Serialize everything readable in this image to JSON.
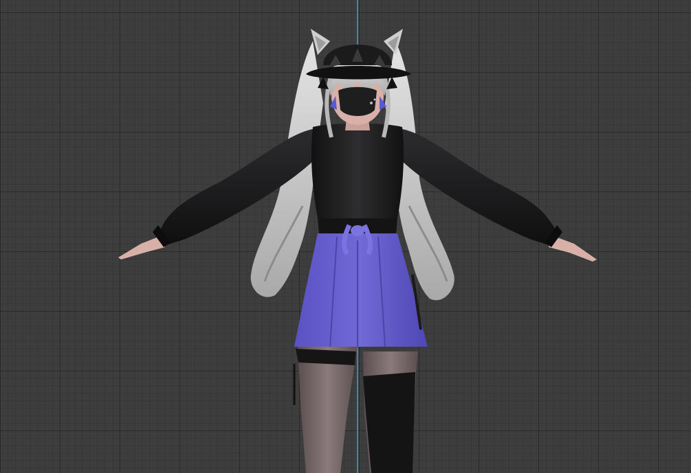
{
  "viewport": {
    "background_color": "#3d3d3d",
    "grid_color": "#2f2f2f",
    "z_axis_color": "#4f7bb6",
    "grid_visible": true
  },
  "model": {
    "colors": {
      "jacket": "#1a1a1b",
      "jacket_highlight": "#3a3a3c",
      "skirt": "#6a63cf",
      "skirt_shadow": "#5048b0",
      "hair": "#cfcfcf",
      "hair_shadow": "#9a9a9a",
      "skin": "#d8b0a8",
      "stocking": "#6b5a5c",
      "sock": "#141414"
    }
  }
}
